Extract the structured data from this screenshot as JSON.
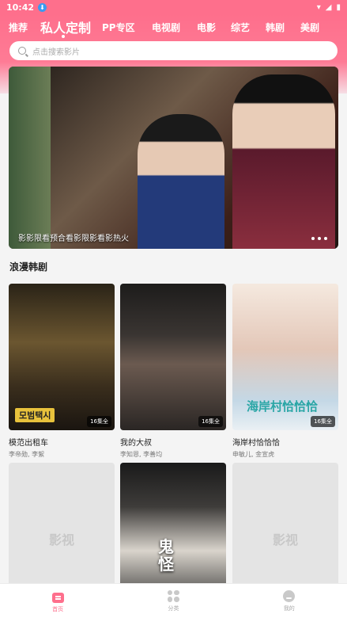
{
  "status_bar": {
    "time": "10:42",
    "download_badge": "⬇"
  },
  "tabs": [
    {
      "label": "推荐"
    },
    {
      "label": "私人定制"
    },
    {
      "label": "PP专区"
    },
    {
      "label": "电视剧"
    },
    {
      "label": "电影"
    },
    {
      "label": "综艺"
    },
    {
      "label": "韩剧"
    },
    {
      "label": "美剧"
    }
  ],
  "active_tab": "私人定制",
  "search": {
    "placeholder": "点击搜索影片"
  },
  "banner": {
    "caption": "影影限看预合看影限影看影热火"
  },
  "section": {
    "title": "浪漫韩剧"
  },
  "cards": [
    {
      "title": "模范出租车",
      "cast": "李帝勋, 李絮",
      "badge": "16集全",
      "logo": "모범택시"
    },
    {
      "title": "我的大叔",
      "cast": "李知恩, 李善均",
      "badge": "16集全"
    },
    {
      "title": "海岸村恰恰恰",
      "cast": "申敏儿, 金宣虎",
      "badge": "16集全",
      "poster_text": "海岸村恰恰恰"
    },
    {
      "placeholder_watermark": "影视"
    },
    {
      "poster_text": "鬼怪"
    },
    {
      "placeholder_watermark": "影视"
    }
  ],
  "bottom_nav": [
    {
      "label": "首页",
      "icon": "home-icon",
      "active": true
    },
    {
      "label": "分类",
      "icon": "category-icon",
      "active": false
    },
    {
      "label": "我的",
      "icon": "profile-icon",
      "active": false
    }
  ],
  "colors": {
    "accent": "#fe6f8c"
  }
}
